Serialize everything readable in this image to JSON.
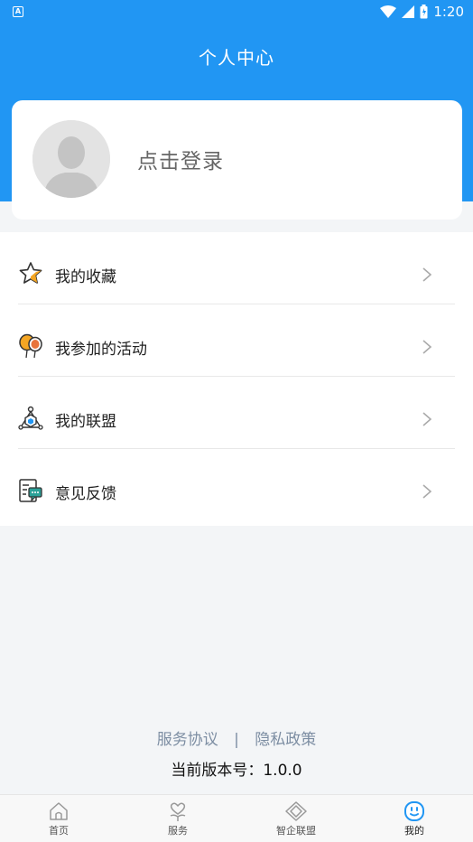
{
  "status_bar": {
    "app_badge": "A",
    "time": "1:20"
  },
  "header": {
    "title": "个人中心"
  },
  "login_card": {
    "login_text": "点击登录"
  },
  "menu": {
    "items": [
      {
        "label": "我的收藏",
        "icon": "star-icon"
      },
      {
        "label": "我参加的活动",
        "icon": "balloons-icon"
      },
      {
        "label": "我的联盟",
        "icon": "alliance-icon"
      },
      {
        "label": "意见反馈",
        "icon": "feedback-icon"
      }
    ]
  },
  "footer": {
    "service_agreement": "服务协议",
    "separator": "|",
    "privacy_policy": "隐私政策",
    "version": "当前版本号：1.0.0"
  },
  "tabbar": {
    "tabs": [
      {
        "label": "首页",
        "icon": "home-icon"
      },
      {
        "label": "服务",
        "icon": "service-icon"
      },
      {
        "label": "智企联盟",
        "icon": "diamond-icon"
      },
      {
        "label": "我的",
        "icon": "profile-face-icon",
        "active": true
      }
    ]
  },
  "colors": {
    "primary": "#2196f3",
    "accent_orange": "#f5a623",
    "link_gray": "#7d8ea3",
    "background": "#f3f5f7"
  }
}
